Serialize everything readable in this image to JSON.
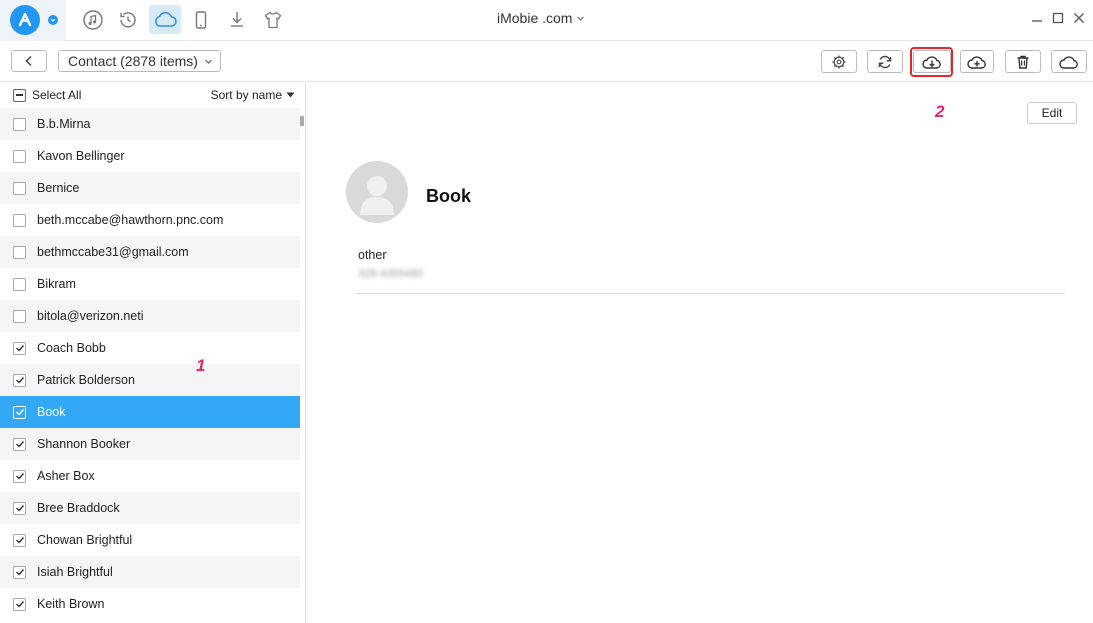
{
  "window": {
    "title": "iMobie .com",
    "controls": [
      "minimize-icon",
      "maximize-icon",
      "close-icon"
    ]
  },
  "nav": {
    "icons": [
      "music-icon",
      "history-icon",
      "cloud-icon",
      "phone-icon",
      "download-icon",
      "tshirt-icon"
    ],
    "active": "cloud-icon"
  },
  "toolbar": {
    "category": "Contact (2878 items)",
    "buttons": [
      "settings-icon",
      "refresh-icon",
      "cloud-download-icon",
      "cloud-upload-icon",
      "trash-icon",
      "cloud-icon"
    ]
  },
  "list": {
    "select_all": "Select All",
    "sort_label": "Sort by name",
    "items": [
      {
        "name": "B.b.Mirna",
        "checked": false
      },
      {
        "name": "Kavon Bellinger",
        "checked": false
      },
      {
        "name": "Bernice",
        "checked": false
      },
      {
        "name": "beth.mccabe@hawthorn.pnc.com",
        "checked": false
      },
      {
        "name": "bethmccabe31@gmail.com",
        "checked": false
      },
      {
        "name": "Bikram",
        "checked": false
      },
      {
        "name": "bitola@verizon.neti",
        "checked": false
      },
      {
        "name": "Coach Bobb",
        "checked": true
      },
      {
        "name": "Patrick Bolderson",
        "checked": true
      },
      {
        "name": "Book",
        "checked": true,
        "selected": true
      },
      {
        "name": "Shannon Booker",
        "checked": true
      },
      {
        "name": "Asher Box",
        "checked": true
      },
      {
        "name": "Bree Braddock",
        "checked": true
      },
      {
        "name": "Chowan Brightful",
        "checked": true
      },
      {
        "name": "Isiah Brightful",
        "checked": true
      },
      {
        "name": "Keith Brown",
        "checked": true
      }
    ]
  },
  "annotations": {
    "step1": "1",
    "step2": "2"
  },
  "detail": {
    "edit_label": "Edit",
    "contact_name": "Book",
    "field_label": "other",
    "field_value": "328-4355480"
  },
  "colors": {
    "accent": "#2196f3",
    "selected_row": "#33a8f5",
    "annotation": "#e0246e",
    "highlight_border": "#e8252f"
  }
}
